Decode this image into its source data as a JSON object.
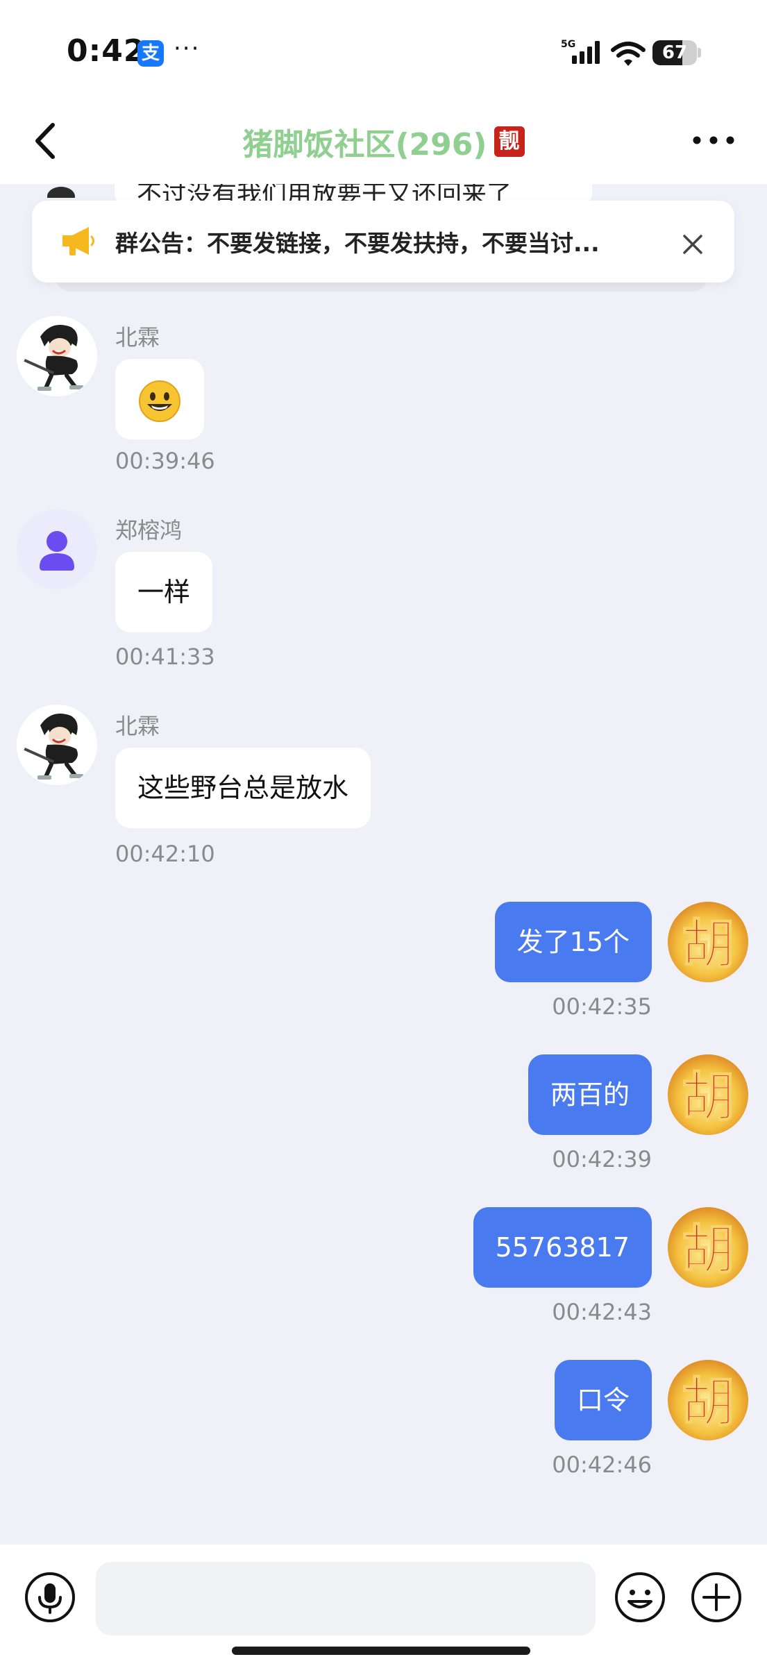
{
  "status_bar": {
    "time": "0:42",
    "app_badge": "支",
    "dots": "···",
    "network": "5G",
    "battery_level": "67",
    "battery_fraction": 0.67
  },
  "header": {
    "title": "猪脚饭社区(296)",
    "badge": "靓",
    "title_color": "#8fcf8f"
  },
  "peek": {
    "text": "不过没有我们用放要干又还回来了"
  },
  "notice": {
    "text": "群公告：不要发链接，不要发扶持，不要当讨..."
  },
  "messages": {
    "m1": {
      "sender": "北霖",
      "content": "😃",
      "time": "00:39:46"
    },
    "m2": {
      "sender": "郑榕鸿",
      "content": "一样",
      "time": "00:41:33"
    },
    "m3": {
      "sender": "北霖",
      "content": "这些野台总是放水",
      "time": "00:42:10"
    },
    "m4": {
      "content": "发了15个",
      "time": "00:42:35"
    },
    "m5": {
      "content": "两百的",
      "time": "00:42:39"
    },
    "m6": {
      "content": "55763817",
      "time": "00:42:43"
    },
    "m7": {
      "content": "口令",
      "time": "00:42:46"
    }
  },
  "self_avatar_char": "胡",
  "input": {
    "value": "",
    "placeholder": ""
  },
  "colors": {
    "accent": "#4a7aef",
    "background": "#f0f1f8",
    "notice_icon": "#f5b91f",
    "default_avatar": "#6a4cf0",
    "badge_red": "#c8231b"
  },
  "icons": [
    "back-arrow-icon",
    "more-icon",
    "megaphone-icon",
    "close-icon",
    "microphone-icon",
    "emoji-icon",
    "plus-icon",
    "person-icon"
  ]
}
